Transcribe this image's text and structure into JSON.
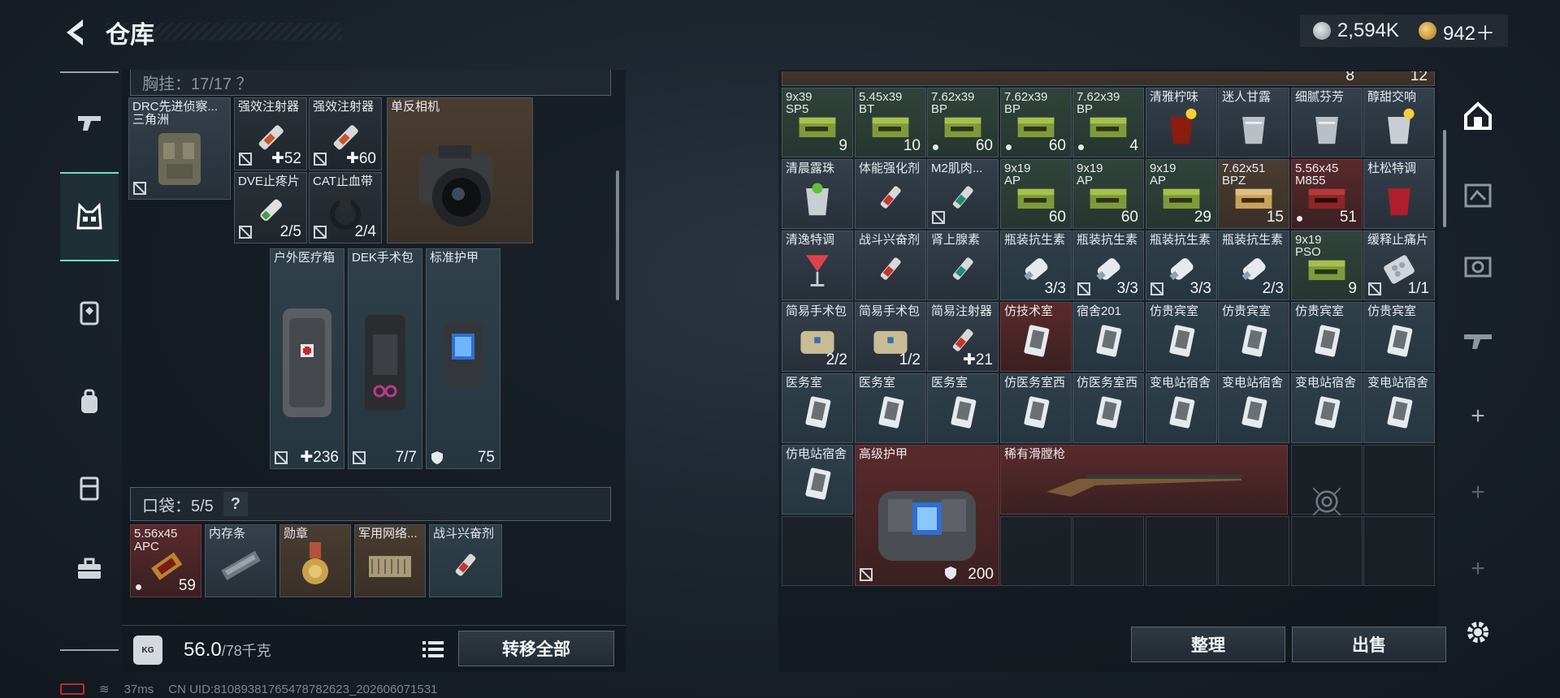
{
  "header": {
    "title": "仓库",
    "silver_amount": "2,594K",
    "gold_amount": "942＋"
  },
  "left_nav": [
    "weapon-icon",
    "vest-icon",
    "armor-icon",
    "backpack-icon",
    "case-icon",
    "toolbox-icon"
  ],
  "rig_header": "胸挂：17/17  ？",
  "rig_items": [
    {
      "name": "DRC先进侦察...",
      "sub": "三角洲",
      "count": ""
    },
    {
      "name": "强效注射器",
      "count": "✚52"
    },
    {
      "name": "强效注射器",
      "count": "✚60"
    },
    {
      "name": "单反相机",
      "count": ""
    },
    {
      "name": "DVE止疼片",
      "count": "2/5"
    },
    {
      "name": "CAT止血带",
      "count": "2/4"
    },
    {
      "name": "户外医疗箱",
      "count": "✚236"
    },
    {
      "name": "DEK手术包",
      "count": "7/7"
    },
    {
      "name": "标准护甲",
      "count": "75"
    }
  ],
  "pocket": {
    "label": "口袋：5/5",
    "help": "?",
    "items": [
      {
        "name": "5.56x45",
        "sub": "APC",
        "count": "59"
      },
      {
        "name": "内存条",
        "count": ""
      },
      {
        "name": "勋章",
        "count": ""
      },
      {
        "name": "军用网络...",
        "count": ""
      },
      {
        "name": "战斗兴奋剂",
        "count": ""
      }
    ]
  },
  "weight": {
    "current": "56.0",
    "max": "/78千克",
    "kg_label": "KG"
  },
  "transfer_all": "转移全部",
  "stash_top_counts": [
    "8",
    "12"
  ],
  "stash_rows": [
    [
      {
        "name": "9x39",
        "sub": "SP5",
        "count": "9",
        "art": "ammo-green"
      },
      {
        "name": "5.45x39",
        "sub": "BT",
        "count": "10",
        "art": "ammo-green"
      },
      {
        "name": "7.62x39",
        "sub": "BP",
        "count": "60",
        "art": "ammo-green",
        "dot": true
      },
      {
        "name": "7.62x39",
        "sub": "BP",
        "count": "60",
        "art": "ammo-green",
        "dot": true
      },
      {
        "name": "7.62x39",
        "sub": "BP",
        "count": "4",
        "art": "ammo-green",
        "dot": true
      },
      {
        "name": "清雅柠味",
        "count": "",
        "art": "drink-red"
      },
      {
        "name": "迷人甘露",
        "count": "",
        "art": "glass"
      },
      {
        "name": "细腻芬芳",
        "count": "",
        "art": "glass"
      },
      {
        "name": "醇甜交响",
        "count": "",
        "art": "drink-lemon"
      }
    ],
    [
      {
        "name": "清晨露珠",
        "count": "",
        "art": "drink-lime"
      },
      {
        "name": "体能强化剂",
        "count": "",
        "art": "syringe-red"
      },
      {
        "name": "M2肌肉...",
        "count": "",
        "art": "syringe-green",
        "badge": true
      },
      {
        "name": "9x19",
        "sub": "AP",
        "count": "60",
        "art": "ammo-green"
      },
      {
        "name": "9x19",
        "sub": "AP",
        "count": "60",
        "art": "ammo-green"
      },
      {
        "name": "9x19",
        "sub": "AP",
        "count": "29",
        "art": "ammo-green"
      },
      {
        "name": "7.62x51",
        "sub": "BPZ",
        "count": "15",
        "art": "ammo-tan"
      },
      {
        "name": "5.56x45",
        "sub": "M855",
        "count": "51",
        "art": "ammo-red",
        "dot": true
      },
      {
        "name": "杜松特调",
        "count": "",
        "art": "drink-red2"
      }
    ],
    [
      {
        "name": "清逸特调",
        "count": "",
        "art": "drink-cocktail"
      },
      {
        "name": "战斗兴奋剂",
        "count": "",
        "art": "syringe-red"
      },
      {
        "name": "肾上腺素",
        "count": "",
        "art": "syringe-green"
      },
      {
        "name": "瓶装抗生素",
        "count": "3/3",
        "art": "bottle"
      },
      {
        "name": "瓶装抗生素",
        "count": "3/3",
        "art": "bottle",
        "badge": true
      },
      {
        "name": "瓶装抗生素",
        "count": "3/3",
        "art": "bottle",
        "badge": true
      },
      {
        "name": "瓶装抗生素",
        "count": "2/3",
        "art": "bottle"
      },
      {
        "name": "9x19",
        "sub": "PSO",
        "count": "9",
        "art": "ammo-green"
      },
      {
        "name": "缓释止痛片",
        "count": "1/1",
        "art": "pills",
        "badge": true
      }
    ],
    [
      {
        "name": "简易手术包",
        "count": "2/2",
        "art": "pouch"
      },
      {
        "name": "简易手术包",
        "count": "1/2",
        "art": "pouch"
      },
      {
        "name": "简易注射器",
        "count": "✚21",
        "art": "syringe-red"
      },
      {
        "name": "仿技术室",
        "count": "",
        "art": "keycard",
        "bg": "red"
      },
      {
        "name": "宿舍201",
        "count": "",
        "art": "keycard"
      },
      {
        "name": "仿贵宾室",
        "count": "",
        "art": "keycard"
      },
      {
        "name": "仿贵宾室",
        "count": "",
        "art": "keycard"
      },
      {
        "name": "仿贵宾室",
        "count": "",
        "art": "keycard"
      },
      {
        "name": "仿贵宾室",
        "count": "",
        "art": "keycard"
      }
    ],
    [
      {
        "name": "医务室",
        "count": "",
        "art": "keycard"
      },
      {
        "name": "医务室",
        "count": "",
        "art": "keycard"
      },
      {
        "name": "医务室",
        "count": "",
        "art": "keycard"
      },
      {
        "name": "仿医务室西",
        "count": "",
        "art": "keycard"
      },
      {
        "name": "仿医务室西",
        "count": "",
        "art": "keycard"
      },
      {
        "name": "变电站宿舍",
        "count": "",
        "art": "keycard"
      },
      {
        "name": "变电站宿舍",
        "count": "",
        "art": "keycard"
      },
      {
        "name": "变电站宿舍",
        "count": "",
        "art": "keycard"
      },
      {
        "name": "变电站宿舍",
        "count": "",
        "art": "keycard"
      }
    ]
  ],
  "stash_bottom": [
    {
      "name": "仿电站宿舍",
      "count": "",
      "art": "keycard"
    },
    {
      "name": "高级护甲",
      "count": "200",
      "art": "armor-big"
    },
    {
      "name": "稀有滑膛枪",
      "count": "",
      "art": "musket"
    }
  ],
  "sort_button": "整理",
  "sell_button": "出售",
  "right_nav": [
    "home-icon",
    "map-icon",
    "photo-icon",
    "weapon-rack-icon",
    "plus-icon",
    "plus-icon",
    "plus-icon"
  ],
  "status_bar": {
    "ping": "37ms",
    "uid": "CN UID:81089381765478782623_202606071531"
  }
}
